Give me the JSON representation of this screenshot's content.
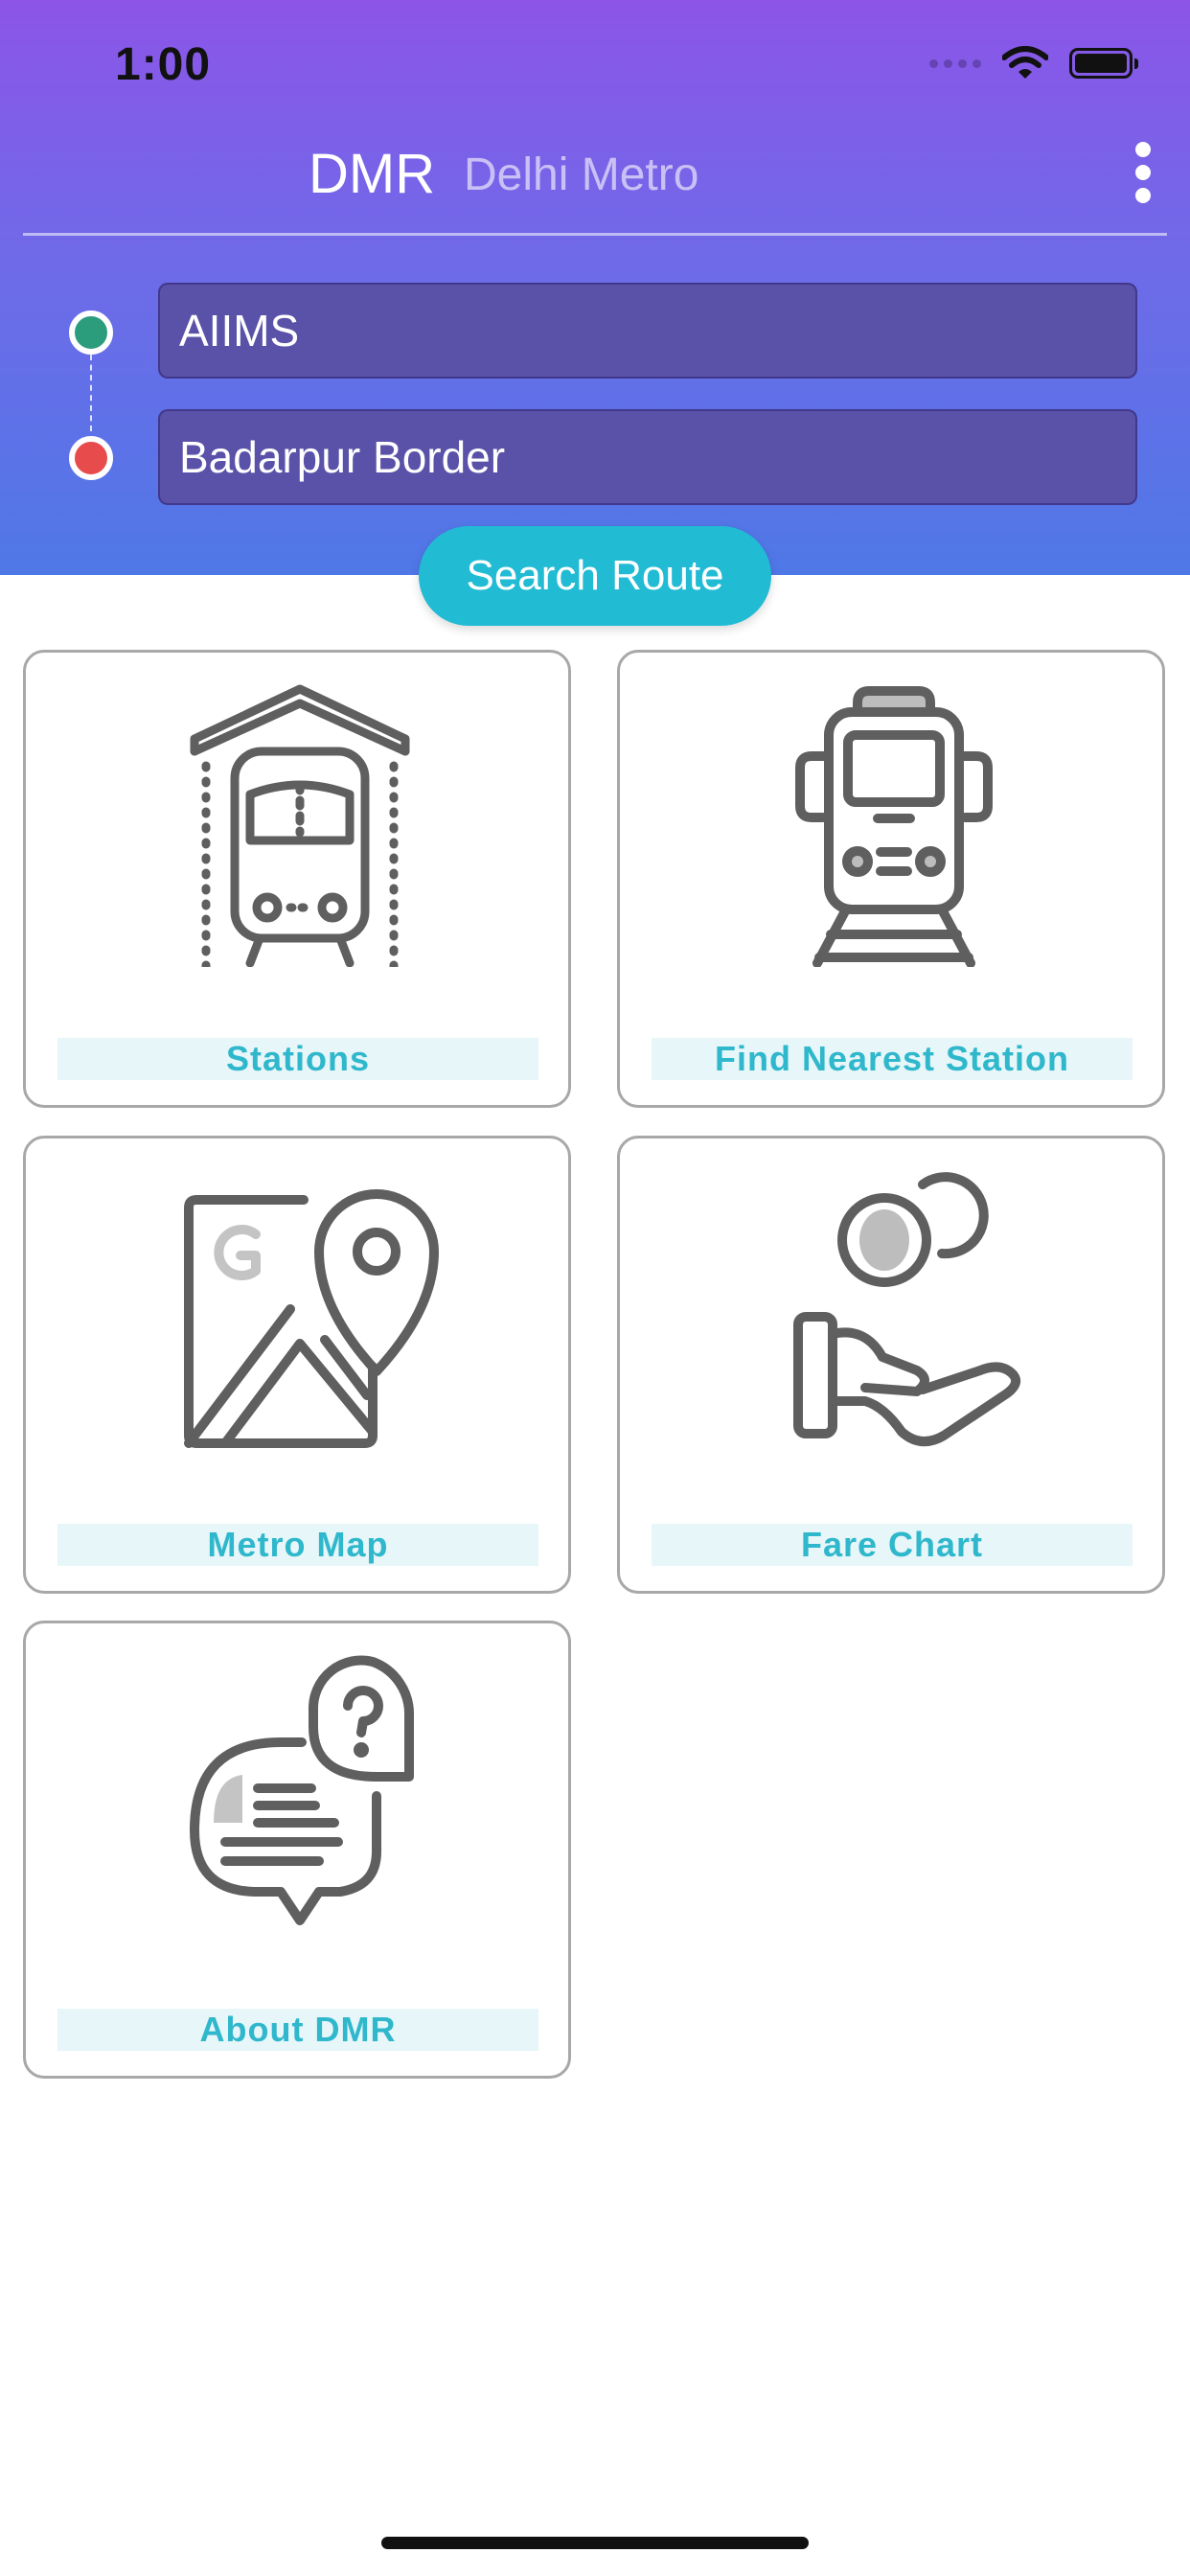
{
  "status_bar": {
    "time": "1:00",
    "icons": [
      "cellular-signal-icon",
      "wifi-icon",
      "battery-icon"
    ]
  },
  "header": {
    "title": "DMR",
    "subtitle": "Delhi Metro",
    "menu_icon": "more-vertical-icon"
  },
  "route": {
    "from": "AIIMS",
    "to": "Badarpur Border",
    "search_label": "Search Route"
  },
  "tiles": [
    {
      "label": "Stations",
      "icon": "station-depot-icon"
    },
    {
      "label": "Find Nearest Station",
      "icon": "metro-train-icon"
    },
    {
      "label": "Metro Map",
      "icon": "map-pin-icon"
    },
    {
      "label": "Fare Chart",
      "icon": "coin-hand-icon"
    },
    {
      "label": "About DMR",
      "icon": "help-chat-icon"
    }
  ],
  "colors": {
    "header_gradient_top": "#8c55e8",
    "header_gradient_bottom": "#4f78e7",
    "input_background": "#5a52a8",
    "search_button": "#21bbd4",
    "tile_label_text": "#2fb7cc",
    "tile_label_background": "#e6f6f9",
    "from_dot": "#2c9d7c",
    "to_dot": "#e84b4b"
  }
}
